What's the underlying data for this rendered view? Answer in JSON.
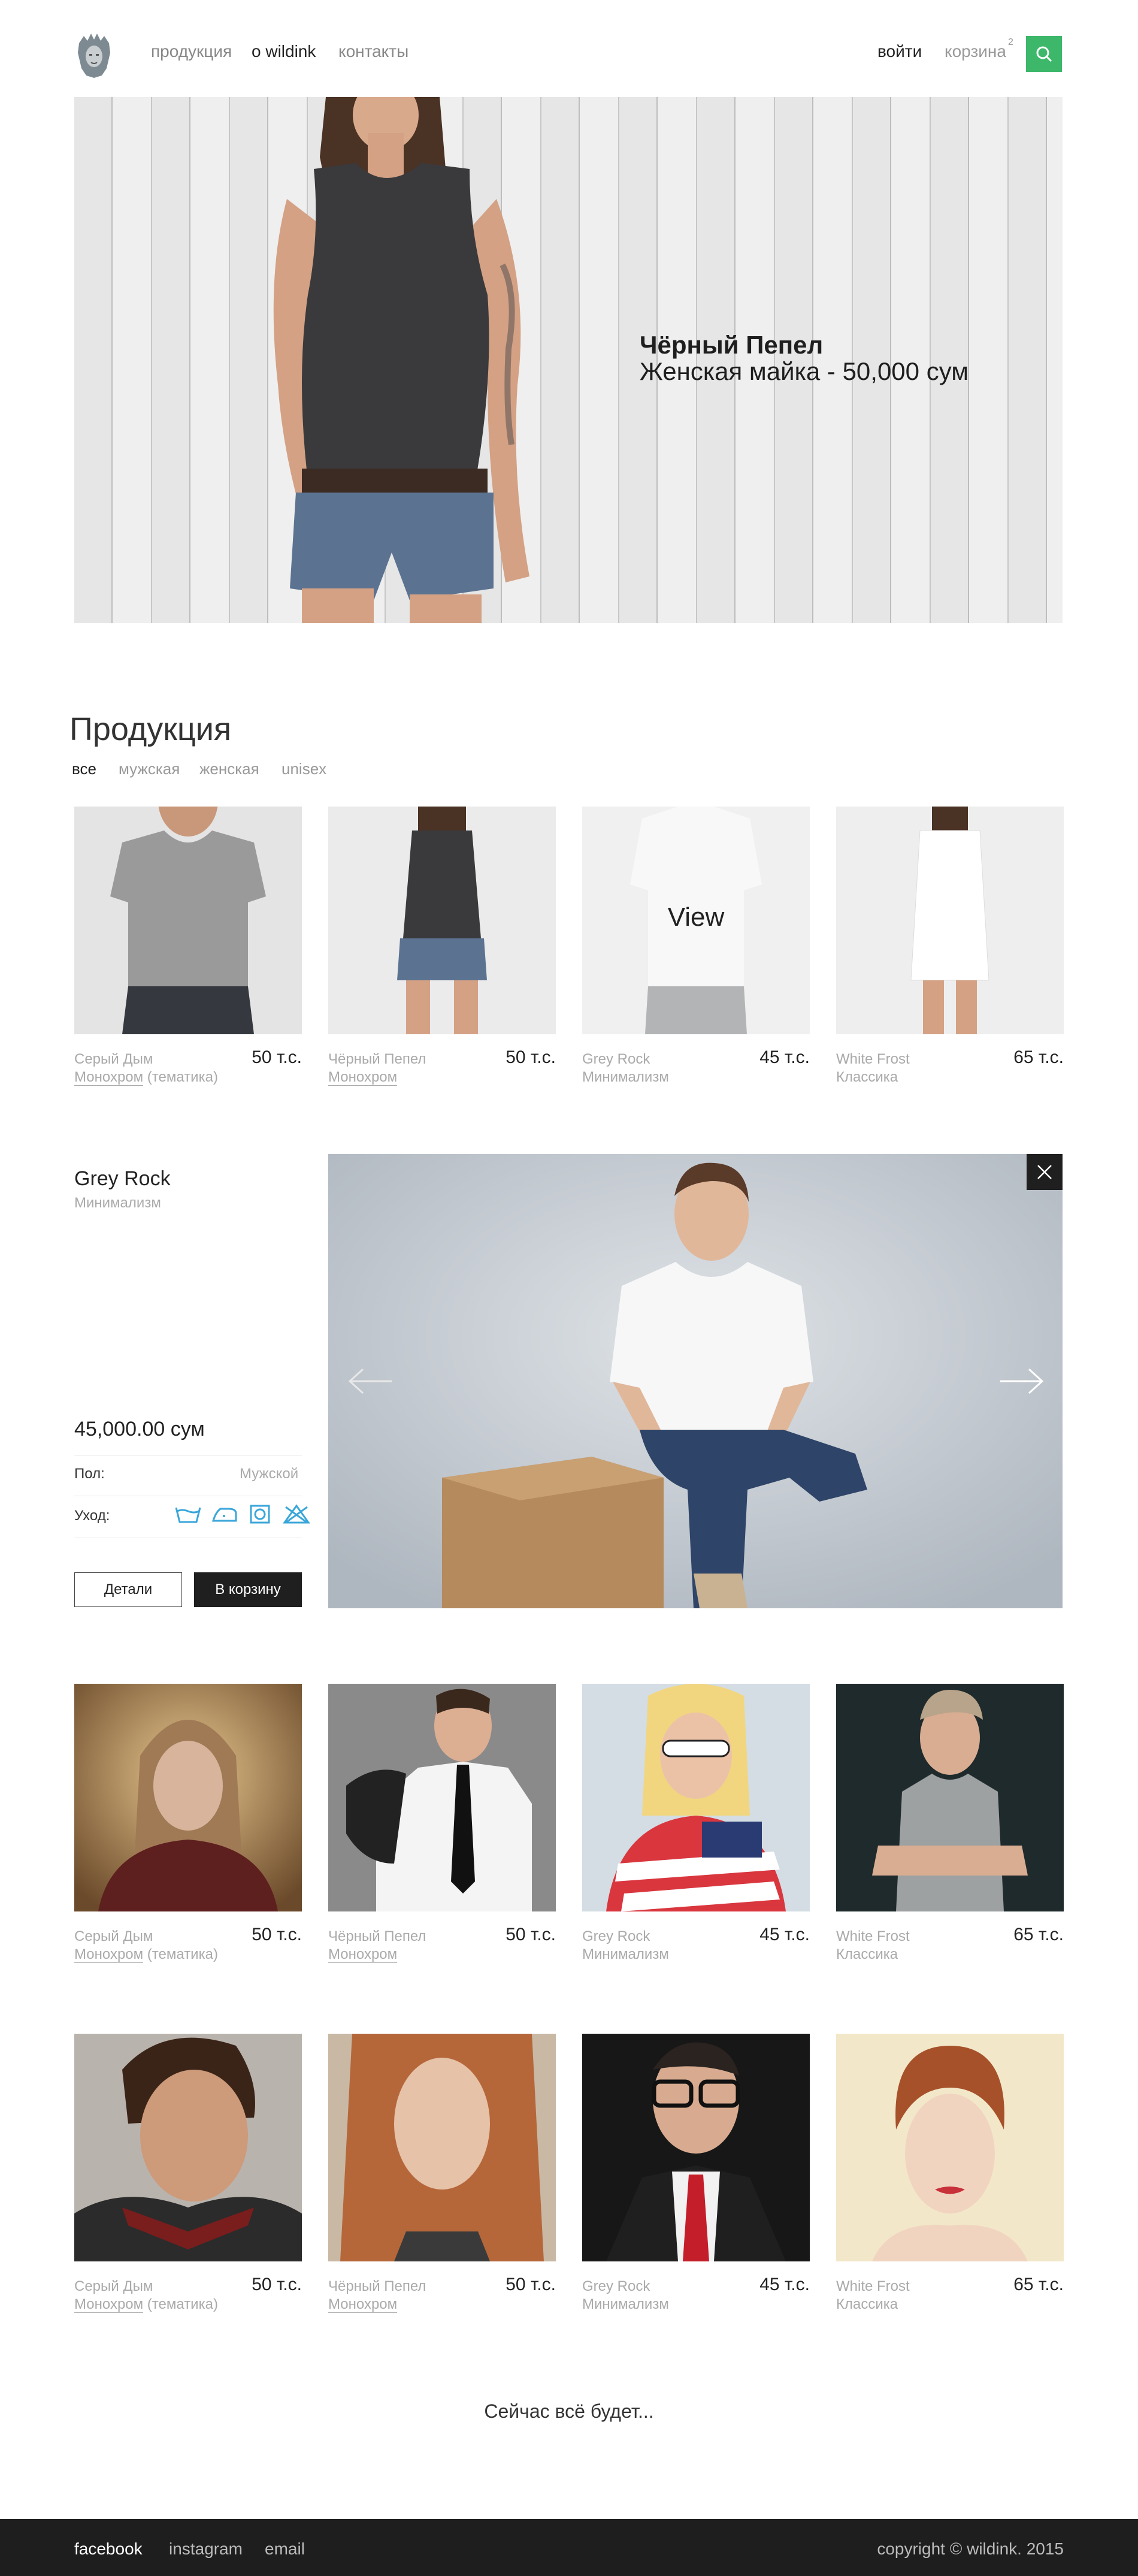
{
  "header": {
    "nav": [
      "продукция",
      "о wildink",
      "контакты"
    ],
    "login": "войти",
    "cart": "корзина",
    "cart_count": "2",
    "logo_icon": "indian-headdress-logo",
    "search_icon": "search-icon",
    "accent_color": "#3db86b"
  },
  "hero": {
    "title": "Чёрный Пепел",
    "subtitle": "Женская майка - 50,000 сум"
  },
  "products_section": {
    "title": "Продукция",
    "filters": [
      "все",
      "мужская",
      "женская",
      "unisex"
    ],
    "view_label": "View"
  },
  "grid1": [
    {
      "name": "Серый Дым",
      "cat": "Монохром",
      "cat_extra": " (тематика)",
      "price": "50 т.с."
    },
    {
      "name": "Чёрный Пепел",
      "cat": "Монохром",
      "cat_extra": "",
      "price": "50 т.с."
    },
    {
      "name": "Grey Rock",
      "cat": "Минимализм",
      "cat_extra": "",
      "price": "45 т.с."
    },
    {
      "name": "White Frost",
      "cat": "Классика",
      "cat_extra": "",
      "price": "65 т.с."
    }
  ],
  "detail": {
    "title": "Grey Rock",
    "subtitle": "Минимализм",
    "price": "45,000.00 сум",
    "gender_label": "Пол:",
    "gender_value": "Мужской",
    "care_label": "Уход:",
    "details_button": "Детали",
    "cart_button": "В корзину"
  },
  "grid2": [
    {
      "name": "Серый Дым",
      "cat": "Монохром",
      "cat_extra": " (тематика)",
      "price": "50 т.с."
    },
    {
      "name": "Чёрный Пепел",
      "cat": "Монохром",
      "cat_extra": "",
      "price": "50 т.с."
    },
    {
      "name": "Grey Rock",
      "cat": "Минимализм",
      "cat_extra": "",
      "price": "45 т.с."
    },
    {
      "name": "White Frost",
      "cat": "Классика",
      "cat_extra": "",
      "price": "65 т.с."
    }
  ],
  "grid3": [
    {
      "name": "Серый Дым",
      "cat": "Монохром",
      "cat_extra": " (тематика)",
      "price": "50 т.с."
    },
    {
      "name": "Чёрный Пепел",
      "cat": "Монохром",
      "cat_extra": "",
      "price": "50 т.с."
    },
    {
      "name": "Grey Rock",
      "cat": "Минимализм",
      "cat_extra": "",
      "price": "45 т.с."
    },
    {
      "name": "White Frost",
      "cat": "Классика",
      "cat_extra": "",
      "price": "65 т.с."
    }
  ],
  "loading_text": "Сейчас всё будет...",
  "footer": {
    "links": [
      "facebook",
      "instagram",
      "email"
    ],
    "copyright": "copyright © wildink. 2015"
  }
}
